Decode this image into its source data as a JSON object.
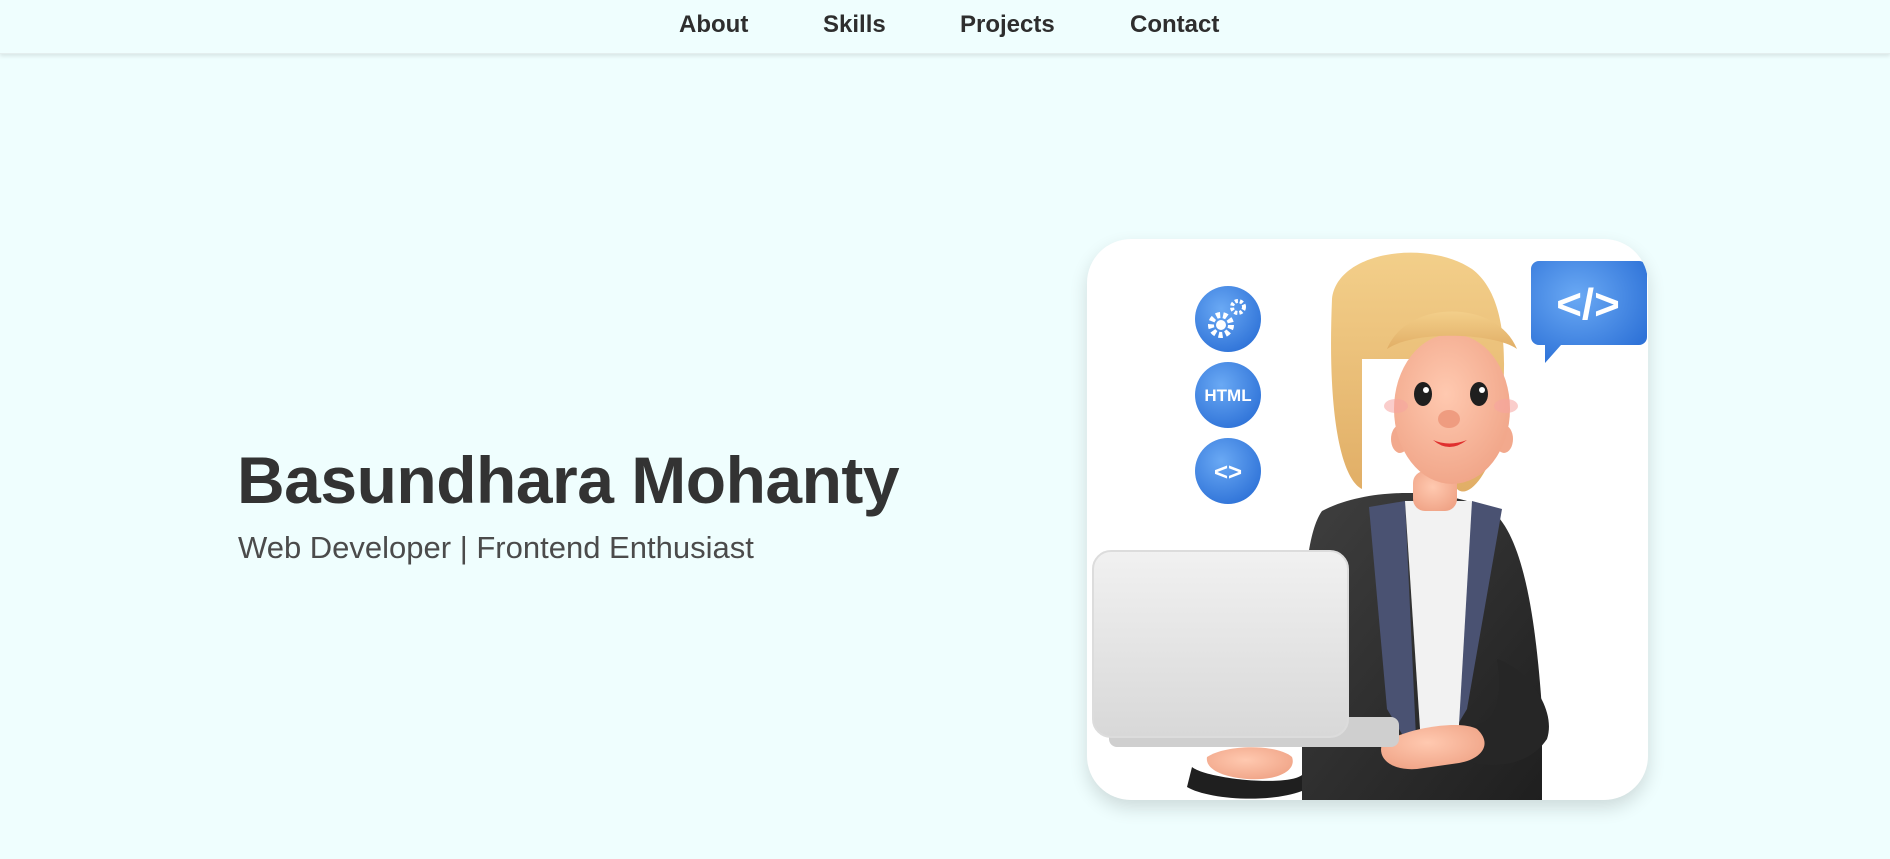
{
  "nav": {
    "items": [
      {
        "label": "About"
      },
      {
        "label": "Skills"
      },
      {
        "label": "Projects"
      },
      {
        "label": "Contact"
      }
    ]
  },
  "hero": {
    "name": "Basundhara Mohanty",
    "subtitle": "Web Developer | Frontend Enthusiast"
  },
  "illustration": {
    "badges": [
      {
        "icon": "gears-icon"
      },
      {
        "icon": "html-icon",
        "text": "HTML"
      },
      {
        "icon": "code-brackets-icon",
        "text": "<>"
      }
    ],
    "speech_bubble": {
      "icon": "code-tag-icon",
      "text": "</>"
    }
  },
  "colors": {
    "background": "#effefe",
    "accent_blue": "#4a8ee6",
    "text_dark": "#333333"
  }
}
